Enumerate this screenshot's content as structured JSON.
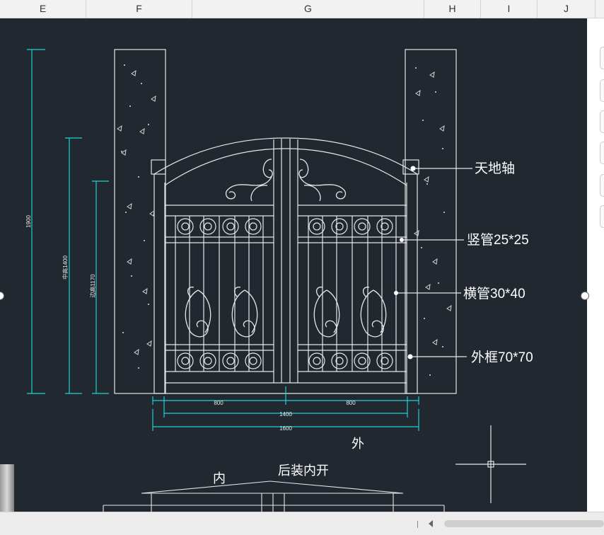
{
  "columns": [
    "E",
    "F",
    "G",
    "H",
    "I",
    "J"
  ],
  "drawing": {
    "callouts": {
      "axle": "天地轴",
      "vertical_tube": "竖管25*25",
      "horizontal_tube": "横管30*40",
      "outer_frame": "外框70*70"
    },
    "dims": {
      "total_height": "1900",
      "middle_height": "中高1400",
      "side_height": "边高1170",
      "leaf_left": "800",
      "leaf_right": "800",
      "gate_width": "1400",
      "overall_width": "1600"
    },
    "labels": {
      "outside": "外",
      "inside": "内",
      "install_note": "后装内开"
    }
  },
  "colors": {
    "background": "#212830",
    "line": "#e6e6e6",
    "dimension": "#19d3d3"
  },
  "icons": {
    "ucs": "crosshair-icon",
    "scroll_left": "scroll-left-icon"
  }
}
